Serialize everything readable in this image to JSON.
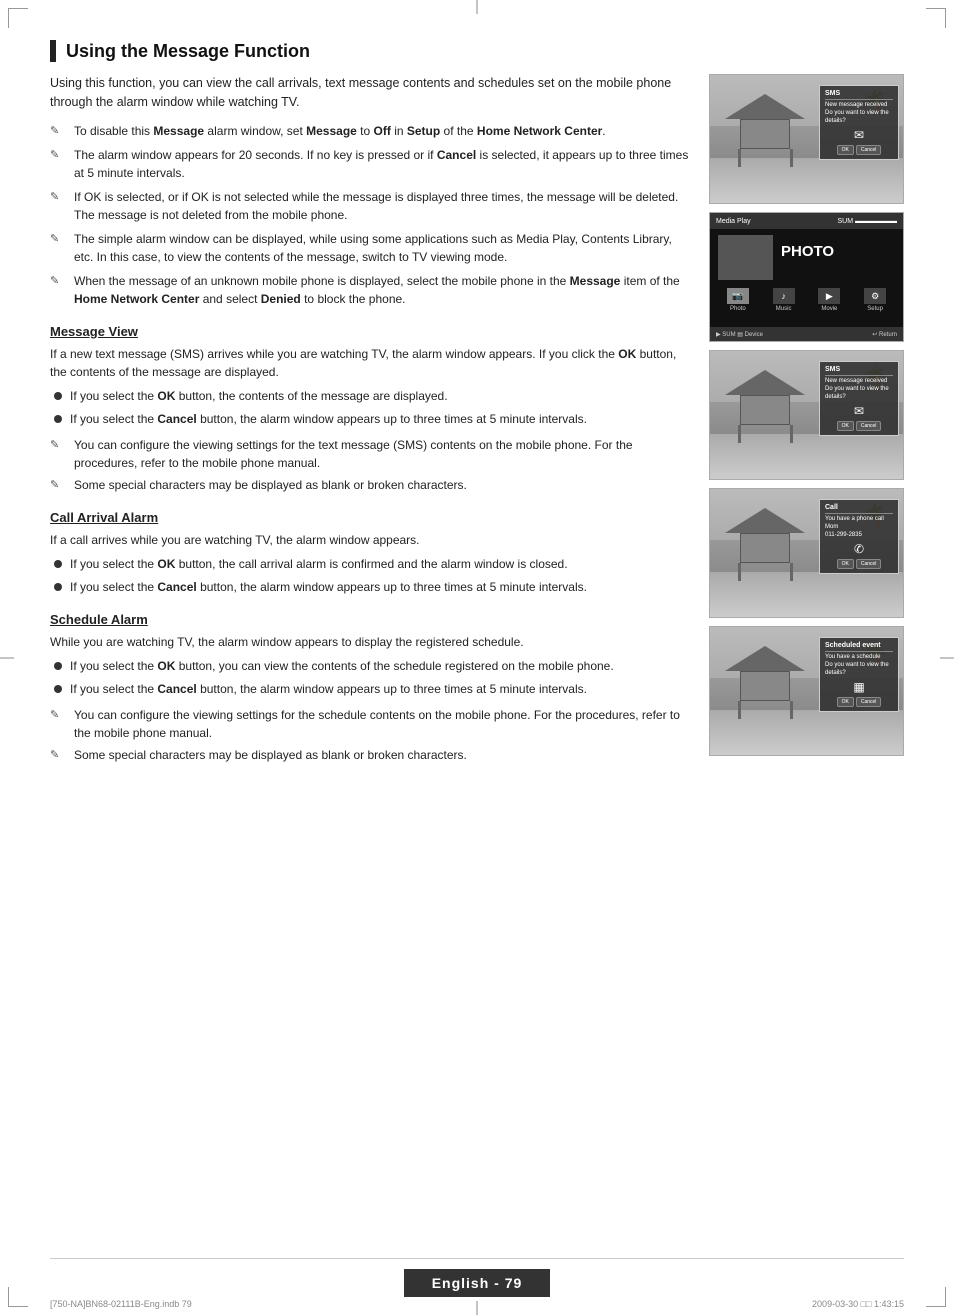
{
  "page": {
    "title": "Using the Message Function",
    "footer": {
      "page_label": "English - 79",
      "file_info": "[750-NA]BN68-02111B-Eng.indb   79",
      "date_info": "2009-03-30   □□ 1:43:15"
    }
  },
  "intro": {
    "text": "Using this function, you can view the call arrivals, text message contents and schedules set on the mobile phone through the alarm window while watching TV."
  },
  "notes_main": [
    {
      "id": 1,
      "text": "To disable this Message alarm window, set Message to Off in Setup of the Home Network Center."
    },
    {
      "id": 2,
      "text": "The alarm window appears for 20 seconds. If no key is pressed or if Cancel is selected, it appears up to three times at 5 minute intervals."
    },
    {
      "id": 3,
      "text": "If OK is selected, or if OK is not selected while the message is displayed three times, the message will be deleted. The message is not deleted from the mobile phone."
    },
    {
      "id": 4,
      "text": "The simple alarm window can be displayed, while using some applications such as Media Play, Contents Library, etc. In this case, to view the contents of the message, switch to TV viewing mode."
    },
    {
      "id": 5,
      "text": "When the message of an unknown mobile phone is displayed, select the mobile phone in the Message item of the Home Network Center and select Denied to block the phone."
    }
  ],
  "subsections": [
    {
      "id": "message-view",
      "title": "Message View",
      "intro": "If a new text message (SMS) arrives while you are watching TV, the alarm window appears. If you click the OK button, the contents of the message are displayed.",
      "bullets": [
        "If you select the OK button, the contents of the message are displayed.",
        "If you select the Cancel button, the alarm window appears up to three times at 5 minute intervals."
      ],
      "notes": [
        "You can configure the viewing settings for the text message (SMS) contents on the mobile phone. For the procedures, refer to the mobile phone manual.",
        "Some special characters may be displayed as blank or broken characters."
      ]
    },
    {
      "id": "call-arrival",
      "title": "Call Arrival Alarm",
      "intro": "If a call arrives while you are watching TV, the alarm window appears.",
      "bullets": [
        "If you select the OK button, the call arrival alarm is confirmed and the alarm window is closed.",
        "If you select the Cancel button, the alarm window appears up to three times at 5 minute intervals."
      ],
      "notes": []
    },
    {
      "id": "schedule-alarm",
      "title": "Schedule Alarm",
      "intro": "While you are watching TV, the alarm window appears to display the registered schedule.",
      "bullets": [
        "If you select the OK button, you can view the contents of the schedule registered on the mobile phone.",
        "If you select the Cancel button, the alarm window appears up to three times at 5 minute intervals."
      ],
      "notes": [
        "You can configure the viewing settings for the schedule contents on the mobile phone. For the procedures, refer to the mobile phone manual.",
        "Some special characters may be displayed as blank or broken characters."
      ]
    }
  ],
  "images": [
    {
      "id": "img1",
      "type": "beach-popup",
      "popup_title": "SMS",
      "popup_body": "New message received\nDo you want to view the details?",
      "popup_icon": "✉"
    },
    {
      "id": "img2",
      "type": "media-play",
      "label": "Media Play",
      "top_label": "PHOTO",
      "icons": [
        "Photo",
        "Music",
        "Movie",
        "Setup"
      ]
    },
    {
      "id": "img3",
      "type": "beach-popup",
      "popup_title": "SMS",
      "popup_body": "New message received\nDo you want to view the details?",
      "popup_icon": "✉"
    },
    {
      "id": "img4",
      "type": "beach-popup",
      "popup_title": "Call",
      "popup_body": "You have a phone call\nMom\n011-299-2835",
      "popup_icon": "✆"
    },
    {
      "id": "img5",
      "type": "beach-popup",
      "popup_title": "Scheduled event",
      "popup_body": "You have a schedule\nDo you want to view the details?",
      "popup_icon": "▦"
    }
  ],
  "keywords": {
    "ok": "OK",
    "cancel": "Cancel",
    "message": "Message",
    "off": "Off",
    "setup": "Setup",
    "home_network_center": "Home Network Center",
    "denied": "Denied",
    "sms": "SMS",
    "media_play": "Media Play",
    "contents_library": "Contents Library"
  }
}
